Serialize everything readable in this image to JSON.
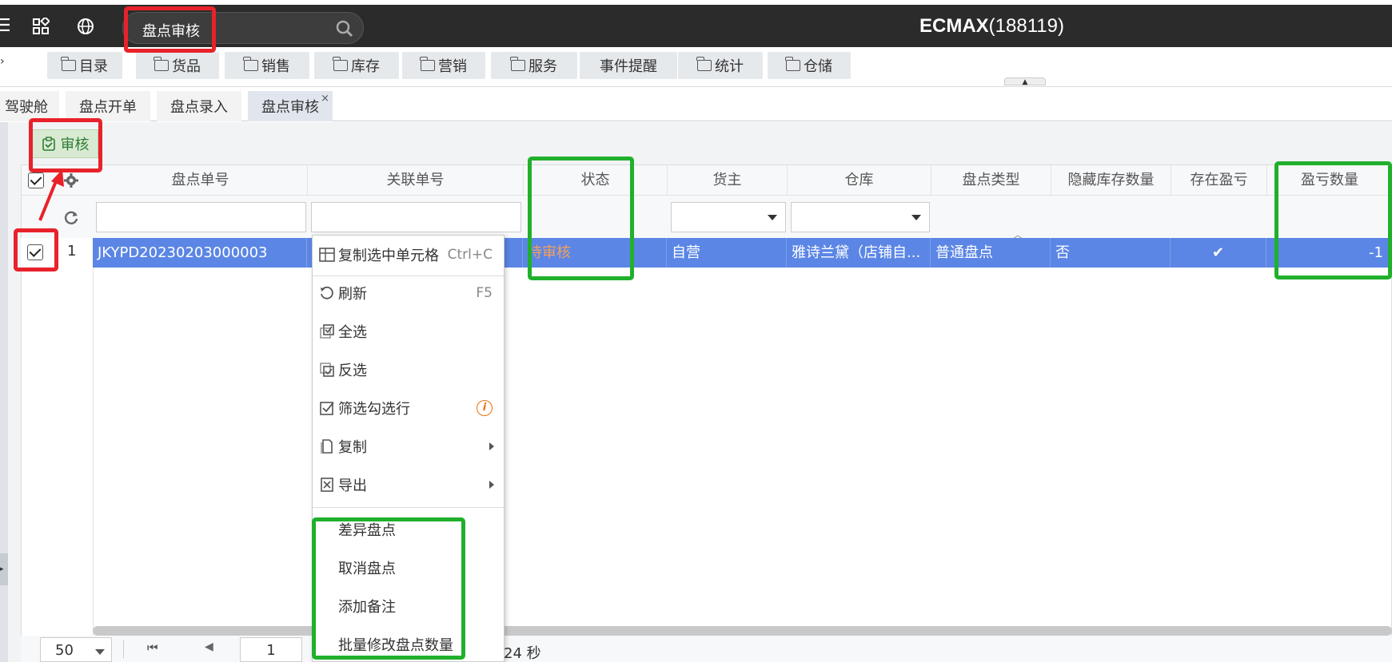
{
  "header": {
    "search_value": "盘点审核",
    "app_title_bold": "ECMAX",
    "app_title_code": "(188119)"
  },
  "menu": {
    "items": [
      {
        "label": "目录",
        "icon": "folder-icon"
      },
      {
        "label": "货品",
        "icon": "folder-icon"
      },
      {
        "label": "销售",
        "icon": "folder-icon"
      },
      {
        "label": "库存",
        "icon": "folder-icon"
      },
      {
        "label": "营销",
        "icon": "folder-icon"
      },
      {
        "label": "服务",
        "icon": "folder-icon"
      },
      {
        "label": "事件提醒",
        "icon": ""
      },
      {
        "label": "统计",
        "icon": "folder-icon"
      },
      {
        "label": "仓储",
        "icon": "folder-icon"
      }
    ]
  },
  "tabs": [
    {
      "label": "驾驶舱"
    },
    {
      "label": "盘点开单"
    },
    {
      "label": "盘点录入"
    },
    {
      "label": "盘点审核",
      "active": true,
      "close": "×"
    }
  ],
  "toolbar": {
    "audit_label": "审核"
  },
  "grid": {
    "columns": [
      "盘点单号",
      "关联单号",
      "状态",
      "货主",
      "仓库",
      "盘点类型",
      "隐藏库存数量",
      "存在盈亏",
      "盈亏数量"
    ],
    "rows": [
      {
        "index": "1",
        "order_no": "JKYPD20230203000003",
        "related_no": "",
        "status": "待审核",
        "owner": "自营",
        "warehouse": "雅诗兰黛（店铺自...",
        "type": "普通盘点",
        "hide_stock": "否",
        "has_profit_loss": "✔",
        "profit_loss_qty": "-1"
      }
    ]
  },
  "footer": {
    "page_size": "50",
    "page_number": "1",
    "time_text": "24 秒"
  },
  "context_menu": {
    "items": [
      {
        "label": "复制选中单元格",
        "shortcut": "Ctrl+C",
        "icon": "table-icon"
      },
      {
        "label": "刷新",
        "shortcut": "F5",
        "icon": "refresh-icon"
      },
      {
        "label": "全选",
        "icon": "select-all-icon"
      },
      {
        "label": "反选",
        "icon": "invert-select-icon"
      },
      {
        "label": "筛选勾选行",
        "icon": "filter-check-icon",
        "info": "i"
      },
      {
        "label": "复制",
        "icon": "copy-icon",
        "submenu": true
      },
      {
        "label": "导出",
        "icon": "export-icon",
        "submenu": true
      },
      {
        "label": "差异盘点"
      },
      {
        "label": "取消盘点"
      },
      {
        "label": "添加备注"
      },
      {
        "label": "批量修改盘点数量"
      }
    ]
  },
  "colors": {
    "topbar": "#2b2b2b",
    "selected_row": "#5b86e5",
    "status_pending": "#f5a05a",
    "annotation_red": "#e8222a",
    "annotation_green": "#20b02b"
  }
}
